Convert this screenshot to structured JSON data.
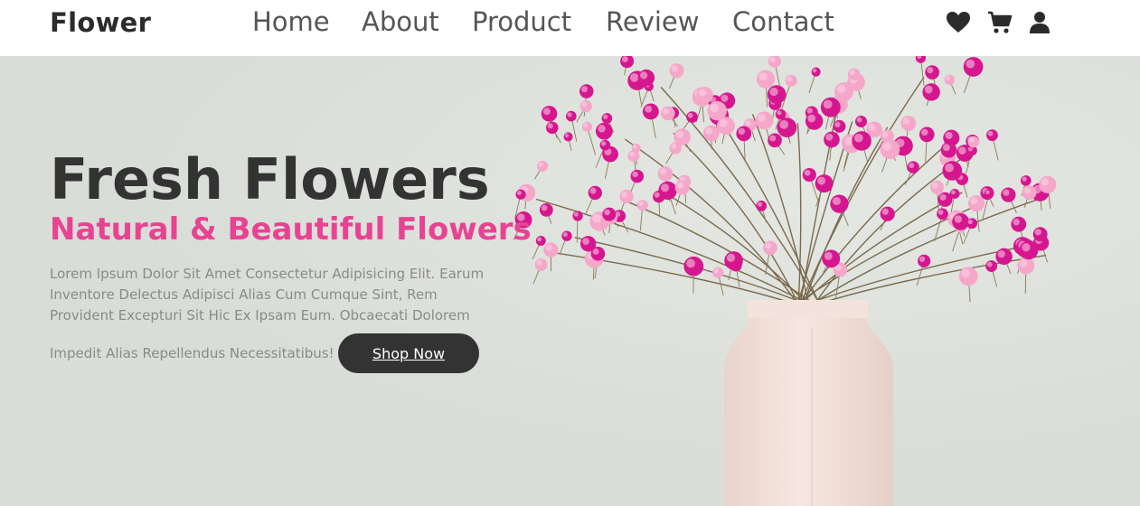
{
  "header": {
    "logo": "Flower",
    "nav": [
      "Home",
      "About",
      "Product",
      "Review",
      "Contact"
    ],
    "icons": [
      "heart-icon",
      "cart-icon",
      "user-icon"
    ]
  },
  "hero": {
    "title": "Fresh Flowers",
    "subtitle": "Natural & Beautiful Flowers",
    "description_lines": [
      "Lorem Ipsum Dolor Sit Amet Consectetur Adipisicing Elit. Earum",
      "Inventore Delectus Adipisci Alias Cum Cumque Sint, Rem",
      "Provident Excepturi Sit Hic Ex Ipsam Eum. Obcaecati Dolorem",
      "Impedit Alias Repellendus Necessitatibus!"
    ],
    "button": "Shop Now"
  },
  "colors": {
    "accent": "#e84393",
    "dark": "#333333",
    "text_muted": "#8a8a8a",
    "hero_bg": "#dfe2dd",
    "vase": "#f3dfd8",
    "flower_magenta": "#d6168f",
    "flower_pink": "#f5a7c9"
  }
}
